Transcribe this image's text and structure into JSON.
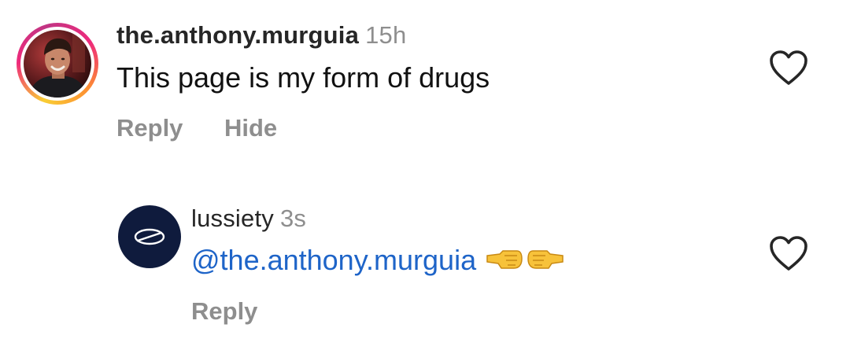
{
  "comments": [
    {
      "username": "the.anthony.murguia",
      "timestamp": "15h",
      "text": "This page is my form of drugs",
      "actions": {
        "reply": "Reply",
        "hide": "Hide"
      },
      "avatar": "profile-photo",
      "like_icon": "heart-outline-icon"
    },
    {
      "username": "lussiety",
      "timestamp": "3s",
      "mention": "@the.anthony.murguia",
      "emojis": [
        "right-facing-fist-emoji",
        "left-facing-fist-emoji"
      ],
      "actions": {
        "reply": "Reply"
      },
      "avatar": "lussiety-logo",
      "like_icon": "heart-outline-icon"
    }
  ],
  "colors": {
    "username": "#262626",
    "secondary_text": "#8e8e8e",
    "mention": "#1e64c8",
    "brand_avatar_bg": "#0f1b3d"
  }
}
